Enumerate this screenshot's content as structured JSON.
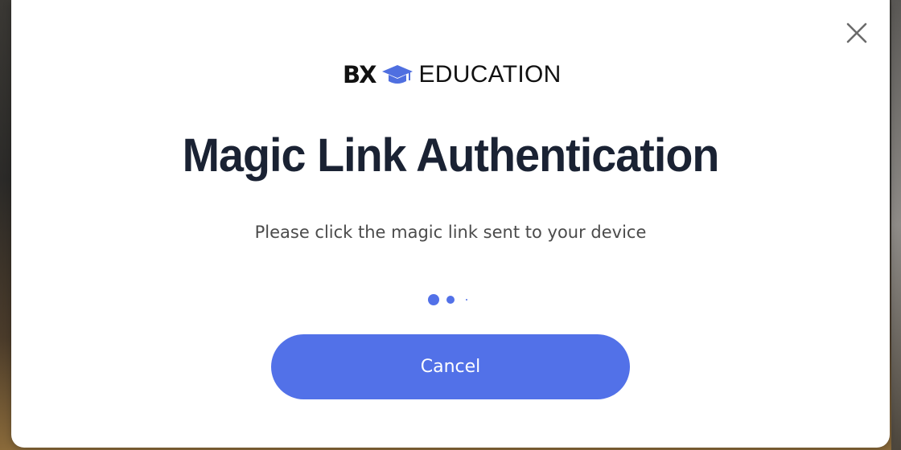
{
  "brand": {
    "prefix": "BX",
    "icon": "graduation-cap-icon",
    "name": "EDUCATION"
  },
  "modal": {
    "title": "Magic Link Authentication",
    "subtitle": "Please click the magic link sent to your device",
    "close_icon": "close-icon",
    "cancel_label": "Cancel"
  },
  "colors": {
    "accent": "#5271e8",
    "title": "#1a2233",
    "text": "#4b4b4b"
  }
}
